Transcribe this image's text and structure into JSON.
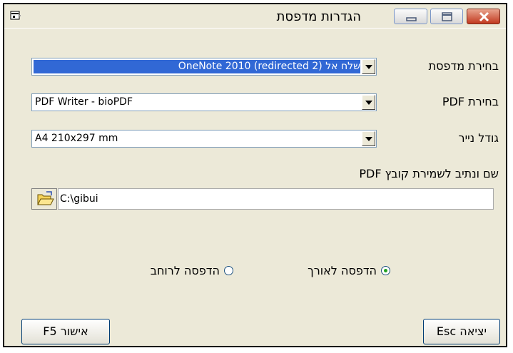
{
  "window": {
    "title": "הגדרות מדפסת"
  },
  "printer": {
    "label": "בחירת מדפסת",
    "value": "שלח אל OneNote 2010 (redirected 2)"
  },
  "pdf": {
    "label": "בחירת PDF",
    "value": "PDF Writer - bioPDF"
  },
  "paper": {
    "label": "גודל נייר",
    "value": "A4 210x297 mm"
  },
  "save_path": {
    "label": "שם ונתיב לשמירת קובץ PDF",
    "value": "C:\\gibui"
  },
  "orientation": {
    "portrait_label": "הדפסה לאורך",
    "landscape_label": "הדפסה לרוחב",
    "selected": "portrait"
  },
  "buttons": {
    "ok_label": "אישור F5",
    "exit_label": "יציאה Esc"
  }
}
